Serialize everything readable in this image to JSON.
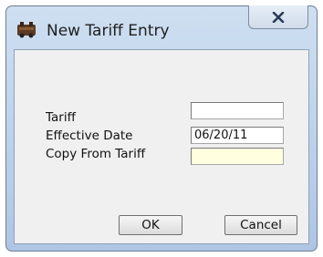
{
  "window": {
    "title": "New Tariff Entry",
    "icon": "tariff-app-icon",
    "close_icon": "close-icon",
    "close_glyph": "X"
  },
  "form": {
    "fields": [
      {
        "label": "Tariff",
        "value": "",
        "placeholder": ""
      },
      {
        "label": "Effective Date",
        "value": "06/20/11",
        "placeholder": ""
      },
      {
        "label": "Copy From Tariff",
        "value": "",
        "placeholder": ""
      }
    ]
  },
  "buttons": {
    "ok_label": "OK",
    "cancel_label": "Cancel"
  },
  "colors": {
    "title_bar": "#bcd1ea",
    "client_background": "#f0f0f0",
    "copy_field_background": "#ffffe0",
    "close_glyph": "#2b3a55"
  }
}
